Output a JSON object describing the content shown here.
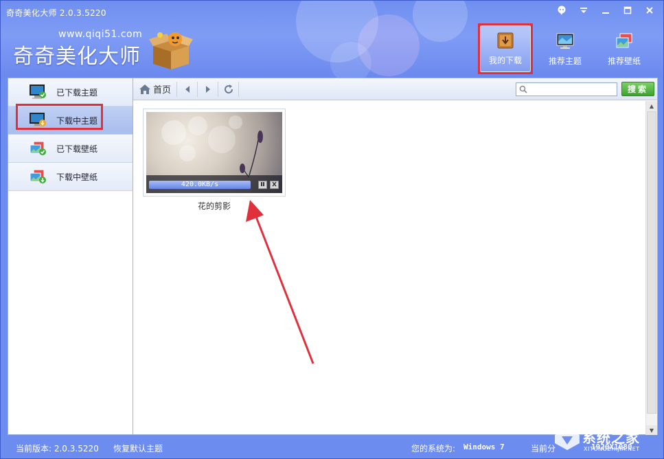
{
  "app": {
    "title": "奇奇美化大师 2.0.3.5220",
    "logo_url": "www.qiqi51.com",
    "logo_name": "奇奇美化大师"
  },
  "window_controls": [
    "feedback-icon",
    "menu-icon",
    "minimize-icon",
    "maximize-icon",
    "close-icon"
  ],
  "top_nav": [
    {
      "label": "我的下载",
      "icon": "download-box-icon",
      "active": true
    },
    {
      "label": "推荐主题",
      "icon": "monitor-icon",
      "active": false
    },
    {
      "label": "推荐壁纸",
      "icon": "wallpaper-icon",
      "active": false
    }
  ],
  "sidebar": {
    "items": [
      {
        "label": "已下载主题",
        "icon": "monitor-check-icon",
        "active": false
      },
      {
        "label": "下载中主题",
        "icon": "monitor-download-icon",
        "active": true
      },
      {
        "label": "已下载壁纸",
        "icon": "wallpaper-check-icon",
        "active": false
      },
      {
        "label": "下载中壁纸",
        "icon": "wallpaper-download-icon",
        "active": false
      }
    ]
  },
  "toolbar": {
    "home_label": "首页",
    "search_placeholder": "",
    "search_button": "搜索"
  },
  "downloads": [
    {
      "name": "花的剪影",
      "speed": "420.0KB/s",
      "progress": 1.0
    }
  ],
  "status": {
    "version_label": "当前版本: 2.0.3.5220",
    "restore_label": "恢复默认主题",
    "system_label": "您的系统为:",
    "system_value": "Windows 7",
    "resolution_label": "当前分",
    "resolution_value": "1920X1080"
  },
  "watermark": {
    "main": "系统之家",
    "sub": "XITONGZHIJIA.NET"
  },
  "colors": {
    "accent": "#6d8cf0",
    "highlight_red": "#e0303c",
    "search_green": "#3da32b"
  }
}
